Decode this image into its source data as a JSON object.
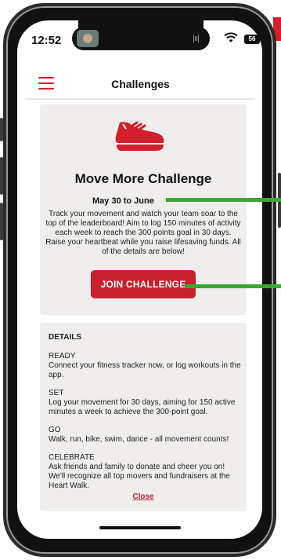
{
  "status_bar": {
    "time": "12:52",
    "battery": "56"
  },
  "header": {
    "title": "Challenges"
  },
  "challenge": {
    "icon": "sneaker-icon",
    "title": "Move More Challenge",
    "dates": "May 30 to June",
    "description": "Track your movement and watch your team soar to the top of the leaderboard! Aim to log 150 minutes of activity each week to reach the 300 points goal in 30 days. Raise your heartbeat while you raise lifesaving funds. All of the details are below!",
    "join_label": "JOIN CHALLENGE"
  },
  "details": {
    "heading": "DETAILS",
    "sections": [
      {
        "label": "READY",
        "text": "Connect your fitness tracker now, or log workouts in the app."
      },
      {
        "label": "SET",
        "text": "Log your movement for 30 days, aiming for 150 active minutes a week to achieve the 300-point goal."
      },
      {
        "label": "GO",
        "text": "Walk, run, bike, swim, dance - all movement counts!"
      },
      {
        "label": "CELEBRATE",
        "text": "Ask friends and family to donate and cheer you on! We'll recognize all top movers and fundraisers at the Heart Walk."
      }
    ],
    "close_label": "Close"
  },
  "colors": {
    "accent": "#c8212b",
    "annotation_arrow": "#3aa832",
    "card_bg": "#efeeec"
  }
}
